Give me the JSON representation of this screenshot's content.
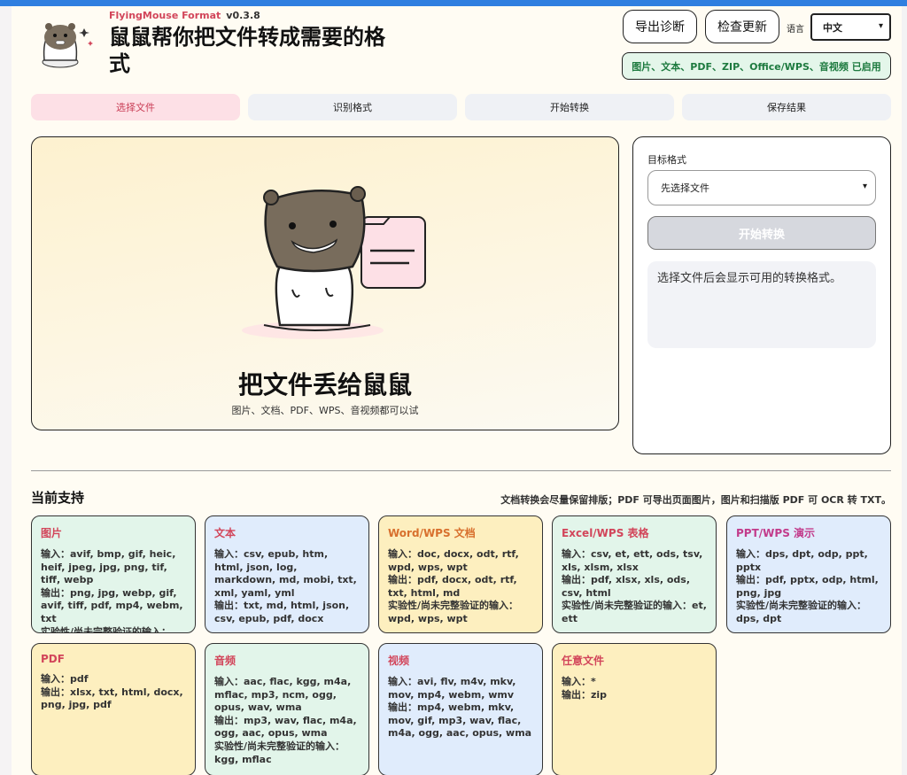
{
  "header": {
    "brand_name": "FlyingMouse Format",
    "version": "v0.3.8",
    "headline": "鼠鼠帮你把文件转成需要的格式",
    "export_diag_label": "导出诊断",
    "check_update_label": "检查更新",
    "language_label": "语言",
    "language_value": "中文",
    "enabled_badge": "图片、文本、PDF、ZIP、Office/WPS、音视频 已启用"
  },
  "steps": [
    "选择文件",
    "识别格式",
    "开始转换",
    "保存结果"
  ],
  "dropzone": {
    "title": "把文件丢给鼠鼠",
    "subtitle": "图片、文档、PDF、WPS、音视频都可以试"
  },
  "panel": {
    "target_label": "目标格式",
    "select_placeholder": "先选择文件",
    "convert_label": "开始转换",
    "hint": "选择文件后会显示可用的转换格式。"
  },
  "support": {
    "title": "当前支持",
    "note": "文档转换会尽量保留排版；PDF 可导出页面图片，图片和扫描版 PDF 可 OCR 转 TXT。",
    "cards": [
      {
        "title": "图片",
        "lines": [
          "输入：avif, bmp, gif, heic, heif, jpeg, jpg, png, tif, tiff, webp",
          "输出：png, jpg, webp, gif, avif, tiff, pdf, mp4, webm, txt",
          "实验性/尚未完整验证的输入：heic, heif"
        ]
      },
      {
        "title": "文本",
        "lines": [
          "输入：csv, epub, htm, html, json, log, markdown, md, mobi, txt, xml, yaml, yml",
          "输出：txt, md, html, json, csv, epub, pdf, docx"
        ]
      },
      {
        "title": "Word/WPS 文档",
        "lines": [
          "输入：doc, docx, odt, rtf, wpd, wps, wpt",
          "输出：pdf, docx, odt, rtf, txt, html, md",
          "实验性/尚未完整验证的输入：wpd, wps, wpt"
        ]
      },
      {
        "title": "Excel/WPS 表格",
        "lines": [
          "输入：csv, et, ett, ods, tsv, xls, xlsm, xlsx",
          "输出：pdf, xlsx, xls, ods, csv, html",
          "实验性/尚未完整验证的输入：et, ett"
        ]
      },
      {
        "title": "PPT/WPS 演示",
        "lines": [
          "输入：dps, dpt, odp, ppt, pptx",
          "输出：pdf, pptx, odp, html, png, jpg",
          "实验性/尚未完整验证的输入：dps, dpt"
        ]
      },
      {
        "title": "PDF",
        "lines": [
          "输入：pdf",
          "输出：xlsx, txt, html, docx, png, jpg, pdf"
        ]
      },
      {
        "title": "音频",
        "lines": [
          "输入：aac, flac, kgg, m4a, mflac, mp3, ncm, ogg, opus, wav, wma",
          "输出：mp3, wav, flac, m4a, ogg, aac, opus, wma",
          "实验性/尚未完整验证的输入：kgg, mflac"
        ]
      },
      {
        "title": "视频",
        "lines": [
          "输入：avi, flv, m4v, mkv, mov, mp4, webm, wmv",
          "输出：mp4, webm, mkv, mov, gif, mp3, wav, flac, m4a, ogg, aac, opus, wma"
        ]
      },
      {
        "title": "任意文件",
        "lines": [
          "输入：*",
          "输出：zip"
        ]
      }
    ]
  },
  "colors": {
    "accent_red": "#d2455a",
    "enabled_green": "#1d7a3f",
    "card_green": "#e2f5ea",
    "card_blue": "#e0ecfc",
    "card_yellow": "#fdefbf"
  }
}
